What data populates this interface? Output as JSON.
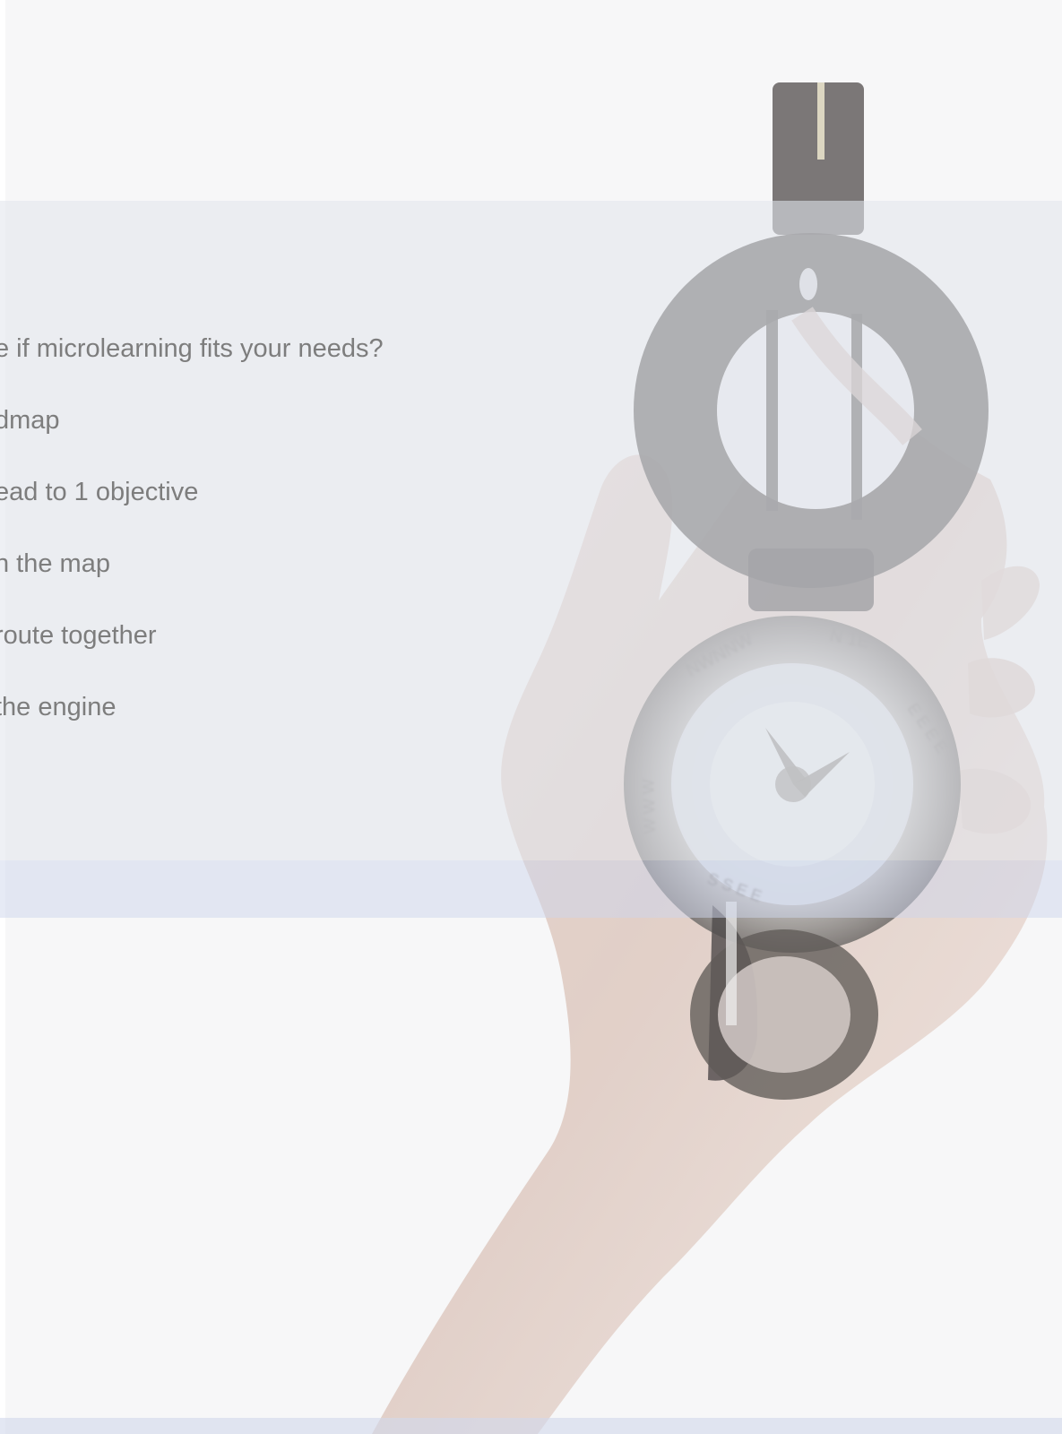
{
  "page": {
    "accent_color": "#e2e6f1",
    "background_color": "#f7f7f8",
    "text_color": "#7d7d7d"
  },
  "hero": {
    "image_description_icon": "hand-compass-image"
  },
  "menu": {
    "items": [
      {
        "label": "e if microlearning fits your needs?"
      },
      {
        "label": "dmap"
      },
      {
        "label": "ead to 1 objective"
      },
      {
        "label": "n the map"
      },
      {
        "label": "route together"
      },
      {
        "label": "the engine"
      }
    ]
  }
}
